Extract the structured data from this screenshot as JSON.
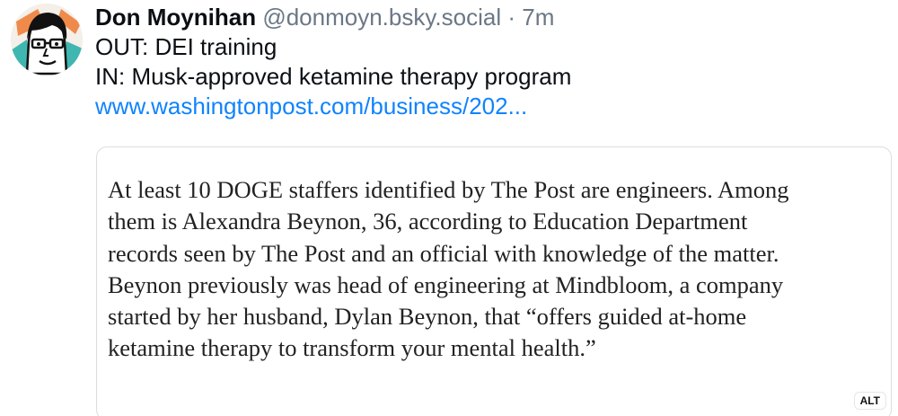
{
  "post": {
    "author_name": "Don Moynihan",
    "handle": "@donmoyn.bsky.social",
    "separator": "·",
    "timestamp": "7m",
    "text_lines": [
      "OUT: DEI training",
      "IN: Musk-approved ketamine therapy program"
    ],
    "link_text": "www.washingtonpost.com/business/202..."
  },
  "embed": {
    "quote_lines": [
      "At least 10 DOGE staffers identified by The Post are engineers. Among",
      "them is Alexandra Beynon, 36, according to Education Department",
      "records seen by The Post and an official with knowledge of the matter.",
      "Beynon previously was head of engineering at Mindbloom, a company",
      "started by her husband, Dylan Beynon, that “offers guided at-home",
      "ketamine therapy to transform your mental health.”"
    ],
    "alt_label": "ALT"
  },
  "colors": {
    "link": "#1083fe",
    "handle_gray": "#6b7785",
    "avatar_teal": "#3fb7b0",
    "avatar_orange": "#f08a4b"
  },
  "icons": {
    "avatar": "cartoon-face-avatar"
  }
}
